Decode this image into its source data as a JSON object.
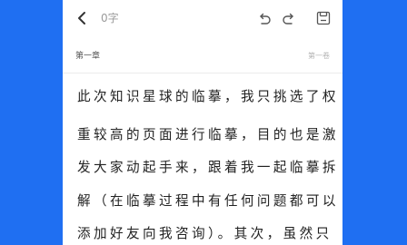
{
  "toolbar": {
    "back_icon": "chevron-left-icon",
    "word_count": "0字",
    "undo_icon": "undo-icon",
    "redo_icon": "redo-icon",
    "save_icon": "save-icon"
  },
  "chapter": {
    "title": "第一章",
    "volume": "第一卷"
  },
  "content": {
    "lines": [
      "此次知识星球的临摹，我只挑选了权",
      "重较高的页面进行临摹，目的也是激",
      "发大家动起手来，跟着我一起临摹拆",
      "解（在临摹过程中有任何问题都可以",
      "添加好友向我咨询）。其次，虽然只"
    ]
  },
  "colors": {
    "background": "#1f6ff2",
    "page": "#ffffff",
    "text": "#222222",
    "muted": "#9a9a9a"
  }
}
